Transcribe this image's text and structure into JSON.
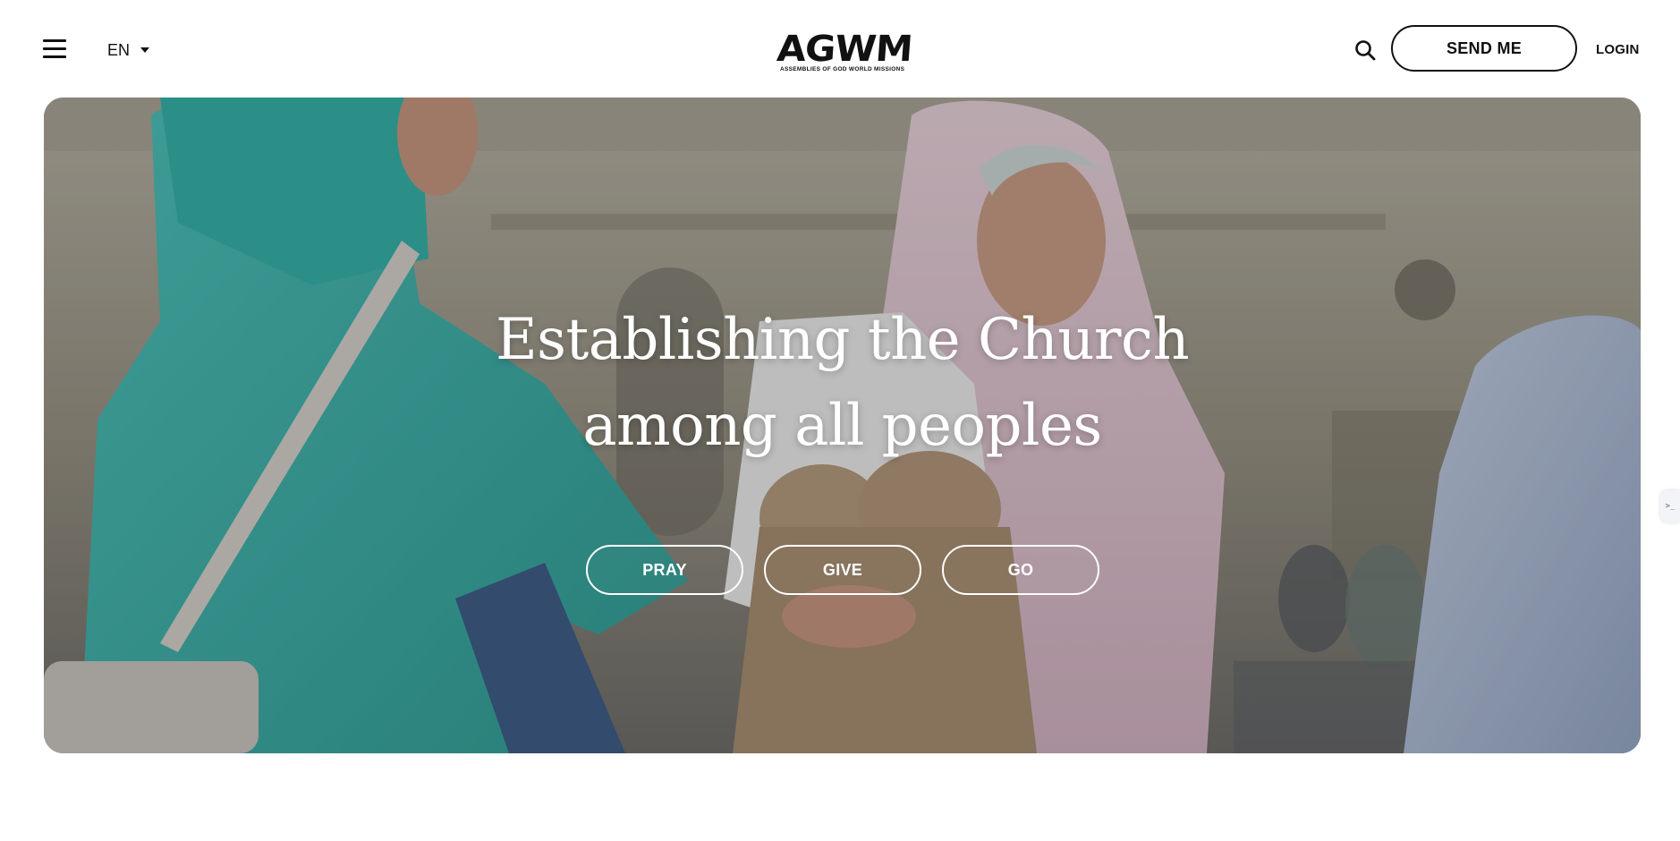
{
  "header": {
    "menu_icon": "hamburger-menu-icon",
    "language": "EN",
    "logo": {
      "mark": "AGWM",
      "subtitle": "ASSEMBLIES OF GOD WORLD MISSIONS"
    },
    "search_icon": "search-icon",
    "send_me_label": "SEND ME",
    "login_label": "LOGIN"
  },
  "hero": {
    "title_line1": "Establishing the Church",
    "title_line2": "among all peoples",
    "buttons": {
      "pray": "PRAY",
      "give": "GIVE",
      "go": "GO"
    }
  },
  "side_tab": {
    "label": ">_",
    "icon": "terminal-icon"
  },
  "colors": {
    "text": "#111111",
    "background": "#ffffff",
    "hero_text": "#ffffff",
    "teal_scarf": "#3fb8b0",
    "pink_scarf": "#e3c8d4"
  }
}
